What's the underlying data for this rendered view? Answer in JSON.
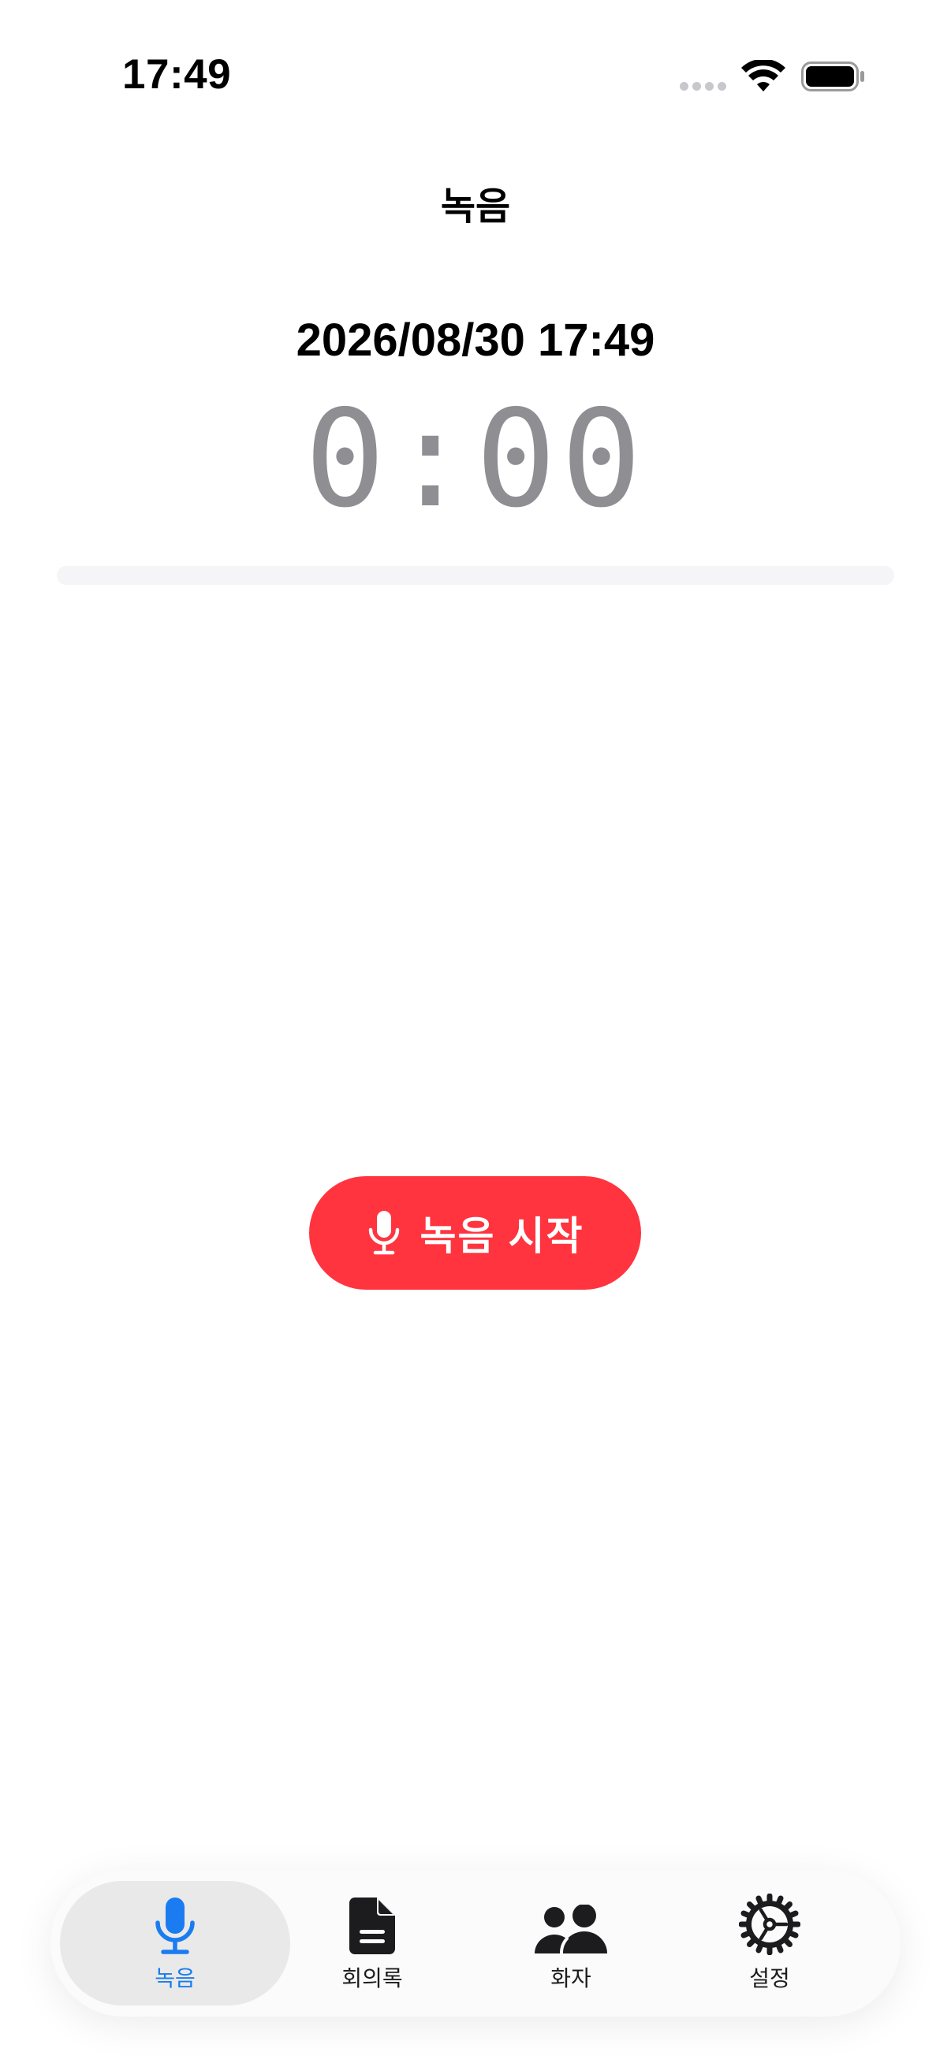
{
  "status_bar": {
    "time": "17:49"
  },
  "nav": {
    "title": "녹음"
  },
  "recording": {
    "datetime": "2026/08/30 17:49",
    "elapsed": "0:00",
    "level": 0,
    "start_button_label": "녹음 시작",
    "button_color": "#ff343f"
  },
  "tabbar": {
    "tabs": [
      {
        "label": "녹음",
        "icon": "mic-icon",
        "active": true
      },
      {
        "label": "회의록",
        "icon": "document-icon",
        "active": false
      },
      {
        "label": "화자",
        "icon": "people-icon",
        "active": false
      },
      {
        "label": "설정",
        "icon": "gear-icon",
        "active": false
      }
    ],
    "active_color": "#1a7cf0"
  }
}
